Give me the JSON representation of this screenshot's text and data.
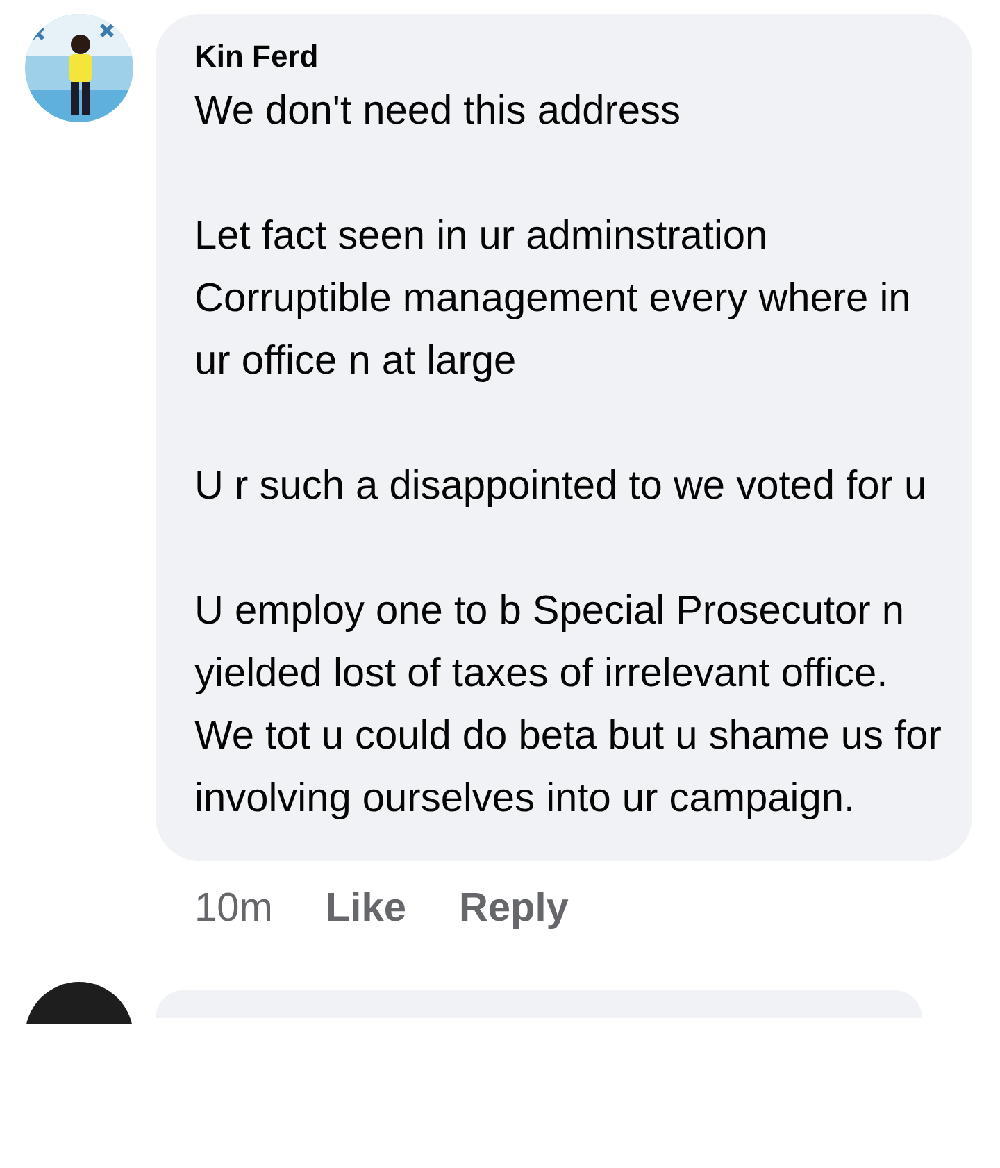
{
  "comment": {
    "author": "Kin Ferd",
    "text": "We don't need this address\n\nLet fact seen in ur adminstration Corruptible management every where in ur office n at large\n\nU r such a disappointed to we voted for u\n\nU employ one to b Special Prosecutor n yielded lost of taxes of irrelevant office.\nWe tot u could do beta but u shame us for involving ourselves into ur campaign.",
    "time": "10m",
    "actions": [
      "Like",
      "Reply"
    ]
  }
}
